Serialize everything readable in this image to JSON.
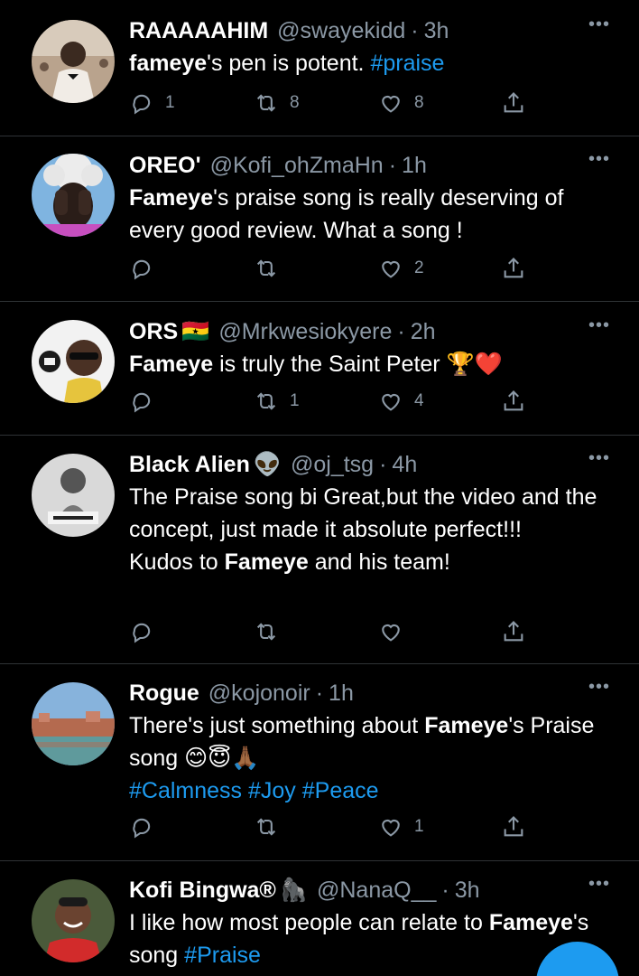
{
  "tweets": [
    {
      "name": "RAAAAAHIM",
      "name_emoji": "",
      "handle": "@swayekidd",
      "time": "3h",
      "text": [
        {
          "t": "fameye",
          "s": "bold"
        },
        {
          "t": "'s pen is potent. ",
          "s": "plain"
        },
        {
          "t": "#praise",
          "s": "tag"
        }
      ],
      "replies": "1",
      "retweets": "8",
      "likes": "8"
    },
    {
      "name": "OREO'",
      "name_emoji": "",
      "handle": "@Kofi_ohZmaHn",
      "time": "1h",
      "text": [
        {
          "t": "Fameye",
          "s": "bold"
        },
        {
          "t": "'s praise song is really deserving of every good review. What a song !",
          "s": "plain"
        }
      ],
      "replies": "",
      "retweets": "",
      "likes": "2"
    },
    {
      "name": "ORS",
      "name_emoji": "🇬🇭",
      "handle": "@Mrkwesiokyere",
      "time": "2h",
      "text": [
        {
          "t": "Fameye",
          "s": "bold"
        },
        {
          "t": " is truly the Saint Peter 🏆❤️",
          "s": "plain"
        }
      ],
      "replies": "",
      "retweets": "1",
      "likes": "4"
    },
    {
      "name": "Black Alien",
      "name_emoji": "👽",
      "handle": "@oj_tsg",
      "time": "4h",
      "text": [
        {
          "t": "The Praise song bi Great,but the video and the concept, just made it absolute perfect!!!\nKudos to ",
          "s": "plain"
        },
        {
          "t": "Fameye",
          "s": "bold"
        },
        {
          "t": " and his team!",
          "s": "plain"
        }
      ],
      "replies": "",
      "retweets": "",
      "likes": ""
    },
    {
      "name": "Rogue",
      "name_emoji": "",
      "handle": "@kojonoir",
      "time": "1h",
      "text": [
        {
          "t": "There's just something about ",
          "s": "plain"
        },
        {
          "t": "Fameye",
          "s": "bold"
        },
        {
          "t": "'s Praise song 😊😇🙏🏾\n",
          "s": "plain"
        },
        {
          "t": "#Calmness #Joy #Peace",
          "s": "tag"
        }
      ],
      "replies": "",
      "retweets": "",
      "likes": "1"
    },
    {
      "name": "Kofi Bingwa®",
      "name_emoji": "🦍",
      "handle": "@NanaQ__",
      "time": "3h",
      "text": [
        {
          "t": "I like how most people can relate to ",
          "s": "plain"
        },
        {
          "t": "Fameye",
          "s": "bold"
        },
        {
          "t": "'s song ",
          "s": "plain"
        },
        {
          "t": "#Praise",
          "s": "tag"
        }
      ],
      "replies": "",
      "retweets": "",
      "likes": ""
    }
  ],
  "icons": {
    "reply": "reply-icon",
    "retweet": "retweet-icon",
    "like": "heart-icon",
    "share": "share-icon",
    "more": "more-options-icon",
    "compose": "compose-tweet-icon"
  },
  "colors": {
    "background": "#000000",
    "text": "#ffffff",
    "muted": "#8b98a5",
    "link": "#1d9bf0",
    "divider": "#2f3336"
  }
}
